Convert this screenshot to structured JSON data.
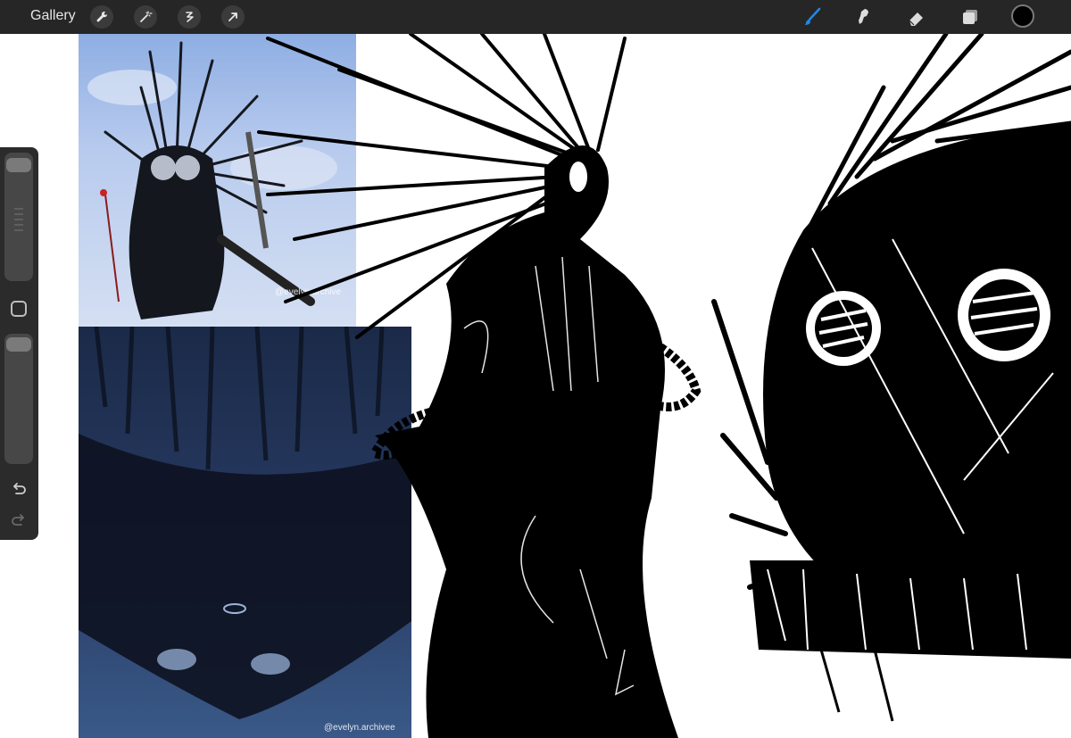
{
  "toolbar": {
    "gallery_label": "Gallery",
    "left_tools": [
      "wrench-icon",
      "magic-wand-icon",
      "selection-icon",
      "transform-arrow-icon"
    ],
    "right_tools": [
      "brush-icon",
      "smudge-icon",
      "eraser-icon",
      "layers-icon"
    ],
    "active_tool": "brush",
    "current_color": "#000000",
    "accent_color": "#1e88e5"
  },
  "sidebar": {
    "controls": [
      "brush-size-slider",
      "modify-button",
      "opacity-slider",
      "undo-icon",
      "redo-icon"
    ]
  },
  "canvas": {
    "reference_top_watermark": "@evelyn.archive",
    "reference_bottom_watermark": "@evelyn.archivee"
  }
}
